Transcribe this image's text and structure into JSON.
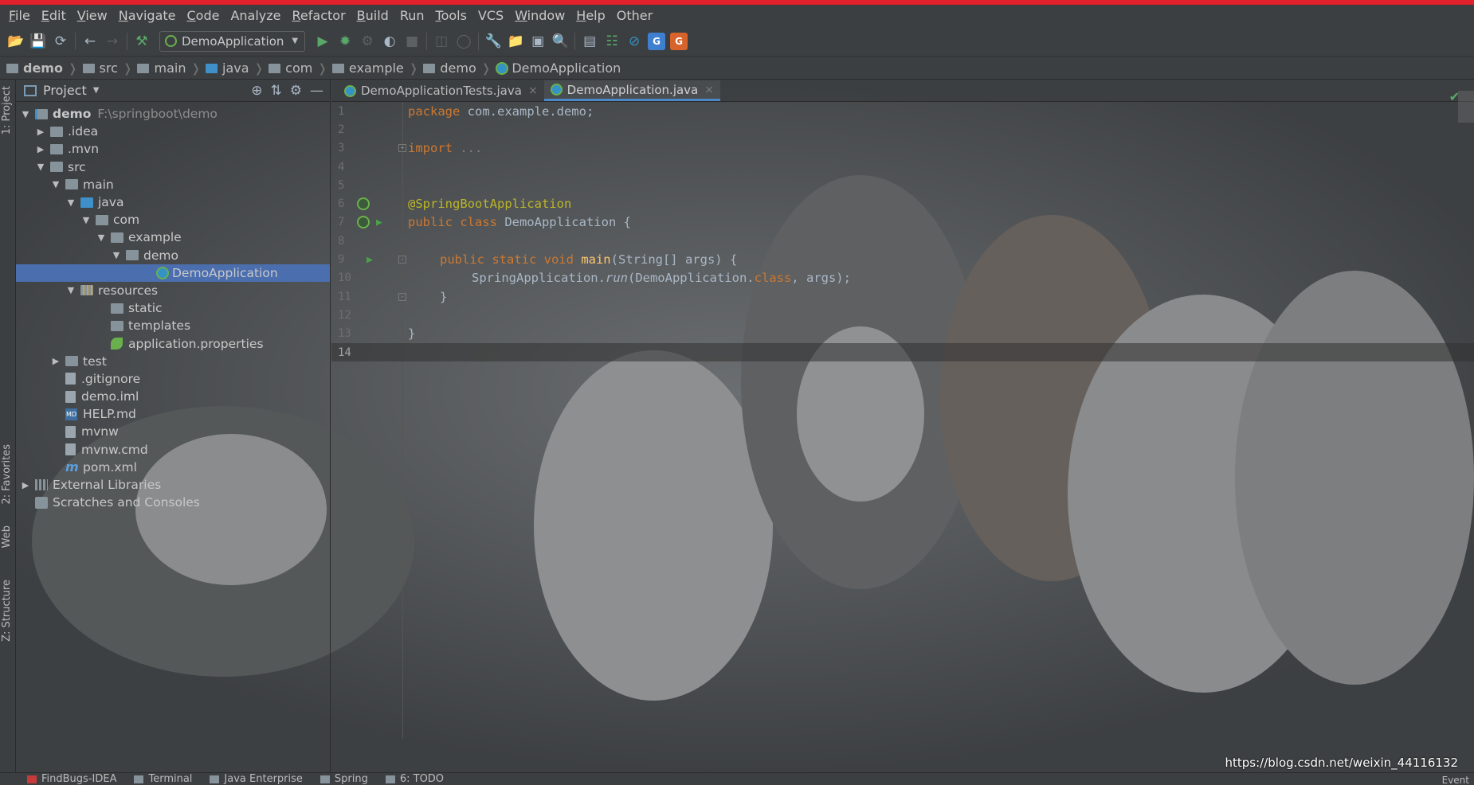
{
  "menu": {
    "items": [
      {
        "mn": "F",
        "rest": "ile"
      },
      {
        "mn": "E",
        "rest": "dit"
      },
      {
        "mn": "V",
        "rest": "iew"
      },
      {
        "mn": "N",
        "rest": "avigate"
      },
      {
        "mn": "C",
        "rest": "ode"
      },
      {
        "mn": "",
        "rest": "Analyze"
      },
      {
        "mn": "R",
        "rest": "efactor"
      },
      {
        "mn": "B",
        "rest": "uild"
      },
      {
        "mn": "",
        "rest": "Run"
      },
      {
        "mn": "T",
        "rest": "ools"
      },
      {
        "mn": "",
        "rest": "VCS"
      },
      {
        "mn": "W",
        "rest": "indow"
      },
      {
        "mn": "H",
        "rest": "elp"
      },
      {
        "mn": "",
        "rest": "Other"
      }
    ]
  },
  "toolbar": {
    "run_config": "DemoApplication",
    "translate_icons": [
      "G",
      "G"
    ]
  },
  "breadcrumb": [
    "demo",
    "src",
    "main",
    "java",
    "com",
    "example",
    "demo",
    "DemoApplication"
  ],
  "left_tool_windows": {
    "project": "1: Project",
    "favorites": "2: Favorites",
    "web": "Web",
    "structure": "Z: Structure"
  },
  "project_panel": {
    "title": "Project",
    "tree": [
      {
        "label": "demo",
        "sub": "F:\\springboot\\demo",
        "depth": 0,
        "toggle": "open",
        "icon": "module"
      },
      {
        "label": ".idea",
        "depth": 1,
        "toggle": "closed",
        "icon": "folder"
      },
      {
        "label": ".mvn",
        "depth": 1,
        "toggle": "closed",
        "icon": "folder"
      },
      {
        "label": "src",
        "depth": 1,
        "toggle": "open",
        "icon": "folder"
      },
      {
        "label": "main",
        "depth": 2,
        "toggle": "open",
        "icon": "folder"
      },
      {
        "label": "java",
        "depth": 3,
        "toggle": "open",
        "icon": "folder-blue"
      },
      {
        "label": "com",
        "depth": 4,
        "toggle": "open",
        "icon": "package"
      },
      {
        "label": "example",
        "depth": 5,
        "toggle": "open",
        "icon": "package"
      },
      {
        "label": "demo",
        "depth": 6,
        "toggle": "open",
        "icon": "package"
      },
      {
        "label": "DemoApplication",
        "depth": 8,
        "toggle": "",
        "icon": "class",
        "selected": true
      },
      {
        "label": "resources",
        "depth": 3,
        "toggle": "open",
        "icon": "resources"
      },
      {
        "label": "static",
        "depth": 5,
        "toggle": "",
        "icon": "folder"
      },
      {
        "label": "templates",
        "depth": 5,
        "toggle": "",
        "icon": "folder"
      },
      {
        "label": "application.properties",
        "depth": 5,
        "toggle": "",
        "icon": "spring"
      },
      {
        "label": "test",
        "depth": 2,
        "toggle": "closed",
        "icon": "folder"
      },
      {
        "label": ".gitignore",
        "depth": 2,
        "toggle": "",
        "icon": "file"
      },
      {
        "label": "demo.iml",
        "depth": 2,
        "toggle": "",
        "icon": "file"
      },
      {
        "label": "HELP.md",
        "depth": 2,
        "toggle": "",
        "icon": "md"
      },
      {
        "label": "mvnw",
        "depth": 2,
        "toggle": "",
        "icon": "file"
      },
      {
        "label": "mvnw.cmd",
        "depth": 2,
        "toggle": "",
        "icon": "file"
      },
      {
        "label": "pom.xml",
        "depth": 2,
        "toggle": "",
        "icon": "maven"
      },
      {
        "label": "External Libraries",
        "depth": 0,
        "toggle": "closed",
        "icon": "library"
      },
      {
        "label": "Scratches and Consoles",
        "depth": 0,
        "toggle": "",
        "icon": "scratch"
      }
    ]
  },
  "editor": {
    "tabs": [
      {
        "label": "DemoApplicationTests.java",
        "active": false
      },
      {
        "label": "DemoApplication.java",
        "active": true
      }
    ],
    "lines": [
      {
        "n": "1"
      },
      {
        "n": "2"
      },
      {
        "n": "3"
      },
      {
        "n": "4"
      },
      {
        "n": "5"
      },
      {
        "n": "6"
      },
      {
        "n": "7"
      },
      {
        "n": "8"
      },
      {
        "n": "9"
      },
      {
        "n": "10"
      },
      {
        "n": "11"
      },
      {
        "n": "12"
      },
      {
        "n": "13"
      },
      {
        "n": "14"
      }
    ],
    "code": {
      "l1_kw": "package",
      "l1_rest": " com.example.demo;",
      "l3_kw": "import",
      "l3_rest": " ...",
      "l6_ann": "@SpringBootApplication",
      "l7_kw": "public class",
      "l7_rest": " DemoApplication {",
      "l9_kw": "public static void",
      "l9_fn": " main",
      "l9_rest": "(String[] args) {",
      "l10_a": "SpringApplication.",
      "l10_run": "run",
      "l10_b": "(DemoApplication.",
      "l10_kw": "class",
      "l10_c": ", args);",
      "l11": "}",
      "l13": "}"
    }
  },
  "statusbar": {
    "tabs": [
      "FindBugs-IDEA",
      "Terminal",
      "Java Enterprise",
      "Spring",
      "6: TODO"
    ],
    "watermark": "https://blog.csdn.net/weixin_44116132",
    "event": "Event"
  }
}
